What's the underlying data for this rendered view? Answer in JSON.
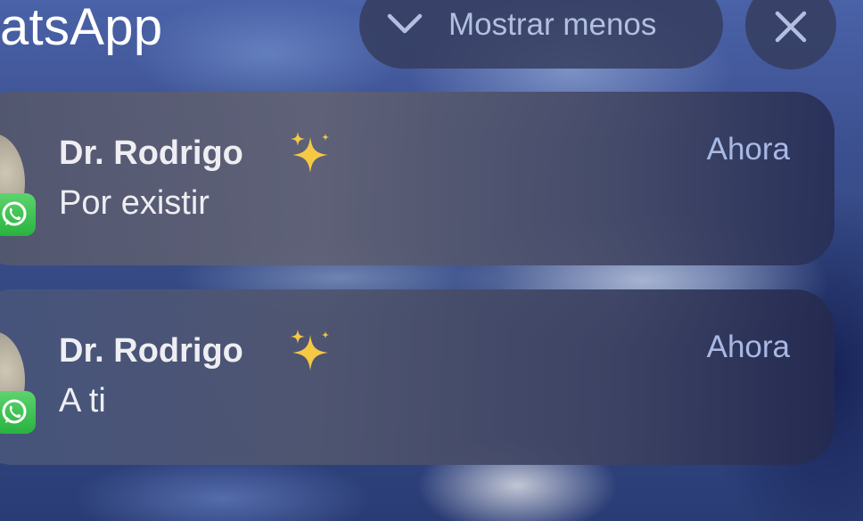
{
  "header": {
    "app_name": "atsApp",
    "collapse_label": "Mostrar menos",
    "collapse_icon": "chevron-down-icon",
    "close_icon": "close-icon"
  },
  "notifications": [
    {
      "sender": "Dr. Rodrigo",
      "emoji": "✨",
      "message": "Por existir",
      "time": "Ahora",
      "app_icon": "whatsapp-icon"
    },
    {
      "sender": "Dr. Rodrigo",
      "emoji": "✨",
      "message": "A ti",
      "time": "Ahora",
      "app_icon": "whatsapp-icon"
    }
  ],
  "colors": {
    "text_primary": "#eeeef3",
    "timestamp": "#a9b8e4",
    "whatsapp_green": "#29b33f",
    "sparkle_yellow": "#f6c945"
  }
}
